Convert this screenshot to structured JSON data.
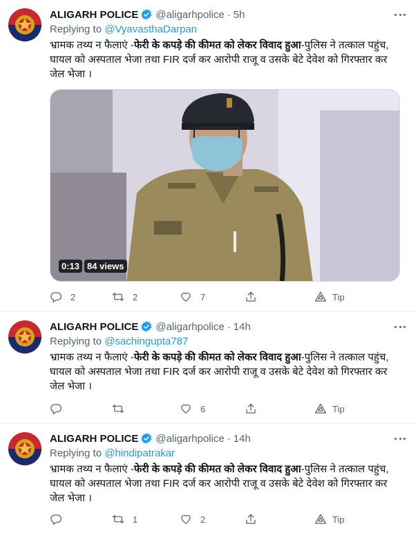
{
  "tweets": [
    {
      "name": "ALIGARH POLICE",
      "handle": "@aligarhpolice",
      "dot": "·",
      "time": "5h",
      "replying_prefix": "Replying to ",
      "replying_to": "@VyavasthaDarpan",
      "text_pre": "भ्रामक तथ्य न फैलाएं -",
      "text_bold": "फेरी के कपड़े की कीमत को लेकर विवाद हुआ",
      "text_post": "-पुलिस ने तत्काल पहुंच, घायल को अस्पताल भेजा तथा FIR दर्ज कर आरोपी राजू व उसके बेटे देवेश को गिरफ्तार कर जेल भेजा ।",
      "video": {
        "duration": "0:13",
        "views": "84 views"
      },
      "replies": "2",
      "retweets": "2",
      "likes": "7",
      "tip": "Tip"
    },
    {
      "name": "ALIGARH POLICE",
      "handle": "@aligarhpolice",
      "dot": "·",
      "time": "14h",
      "replying_prefix": "Replying to ",
      "replying_to": "@sachingupta787",
      "text_pre": "भ्रामक तथ्य न फैलाएं -",
      "text_bold": "फेरी के कपड़े की कीमत को लेकर विवाद हुआ",
      "text_post": "-पुलिस ने तत्काल पहुंच, घायल को अस्पताल भेजा तथा FIR दर्ज कर आरोपी राजू व उसके बेटे देवेश को गिरफ्तार कर जेल भेजा ।",
      "replies": "",
      "retweets": "",
      "likes": "6",
      "tip": "Tip"
    },
    {
      "name": "ALIGARH POLICE",
      "handle": "@aligarhpolice",
      "dot": "·",
      "time": "14h",
      "replying_prefix": "Replying to ",
      "replying_to": "@hindipatrakar",
      "text_pre": "भ्रामक तथ्य न फैलाएं -",
      "text_bold": "फेरी के कपड़े की कीमत को लेकर विवाद हुआ",
      "text_post": "-पुलिस ने तत्काल पहुंच, घायल को अस्पताल भेजा तथा FIR दर्ज कर आरोपी राजू व उसके बेटे देवेश को गिरफ्तार कर जेल भेजा ।",
      "replies": "",
      "retweets": "1",
      "likes": "2",
      "tip": "Tip"
    }
  ],
  "icons": {
    "verified": "verified-badge-icon",
    "more": "more-options-icon",
    "reply": "reply-icon",
    "retweet": "retweet-icon",
    "like": "like-icon",
    "share": "share-icon",
    "tip": "tip-icon"
  },
  "colors": {
    "accent": "#1d9bf0",
    "secondary_text": "#536471",
    "primary_text": "#0f1419",
    "divider": "#eff3f4"
  }
}
